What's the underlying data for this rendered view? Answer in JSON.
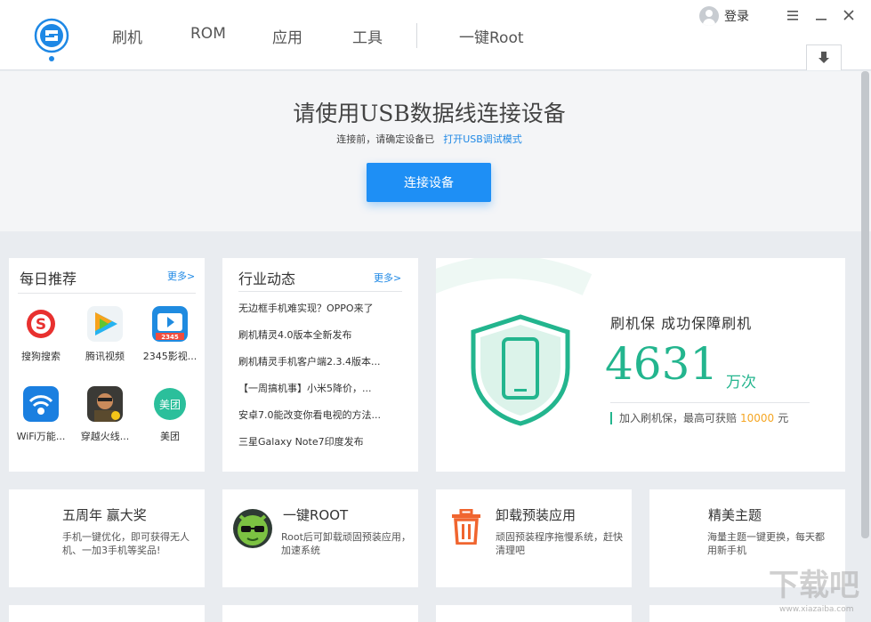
{
  "nav": {
    "items": [
      {
        "label": "刷机"
      },
      {
        "label": "ROM"
      },
      {
        "label": "应用"
      },
      {
        "label": "工具"
      },
      {
        "label": "一键Root"
      }
    ]
  },
  "user": {
    "login_label": "登录"
  },
  "banner": {
    "title": "请使用USB数据线连接设备",
    "sub_prefix": "连接前，请确定设备已",
    "sub_link": "打开USB调试模式",
    "button_label": "连接设备"
  },
  "daily": {
    "title": "每日推荐",
    "more": "更多>",
    "apps": [
      {
        "label": "搜狗搜索",
        "icon": "sogou-search-icon"
      },
      {
        "label": "腾讯视频",
        "icon": "tencent-video-icon"
      },
      {
        "label": "2345影视...",
        "icon": "2345-video-icon"
      },
      {
        "label": "WiFi万能...",
        "icon": "wifi-key-icon"
      },
      {
        "label": "穿越火线...",
        "icon": "crossfire-icon"
      },
      {
        "label": "美团",
        "icon": "meituan-icon"
      }
    ]
  },
  "industry": {
    "title": "行业动态",
    "more": "更多>",
    "news": [
      "无边框手机难实现？OPPO来了",
      "刷机精灵4.0版本全新发布",
      "刷机精灵手机客户端2.3.4版本...",
      "【一周搞机事】小米5降价，...",
      "安卓7.0能改变你看电视的方法...",
      "三星Galaxy Note7印度发布"
    ]
  },
  "guard": {
    "title": "刷机保  成功保障刷机",
    "count": "4631",
    "unit": "万次",
    "note_prefix": "加入刷机保，最高可获赔",
    "amount": "10000",
    "note_suffix": "元"
  },
  "features": [
    {
      "title": "五周年  赢大奖",
      "desc": "手机一键优化，即可获得无人机、一加3手机等奖品!"
    },
    {
      "title": "一键ROOT",
      "desc": "Root后可卸载顽固预装应用，加速系统"
    },
    {
      "title": "卸载预装应用",
      "desc": "顽固预装程序拖慢系统，赶快清理吧"
    },
    {
      "title": "精美主题",
      "desc": "海量主题一键更换，每天都用新手机"
    }
  ],
  "watermark": {
    "text": "下载吧",
    "url": "www.xiazaiba.com"
  },
  "colors": {
    "accent": "#1e8ff5",
    "green": "#23b58e",
    "orange": "#f5a623"
  }
}
